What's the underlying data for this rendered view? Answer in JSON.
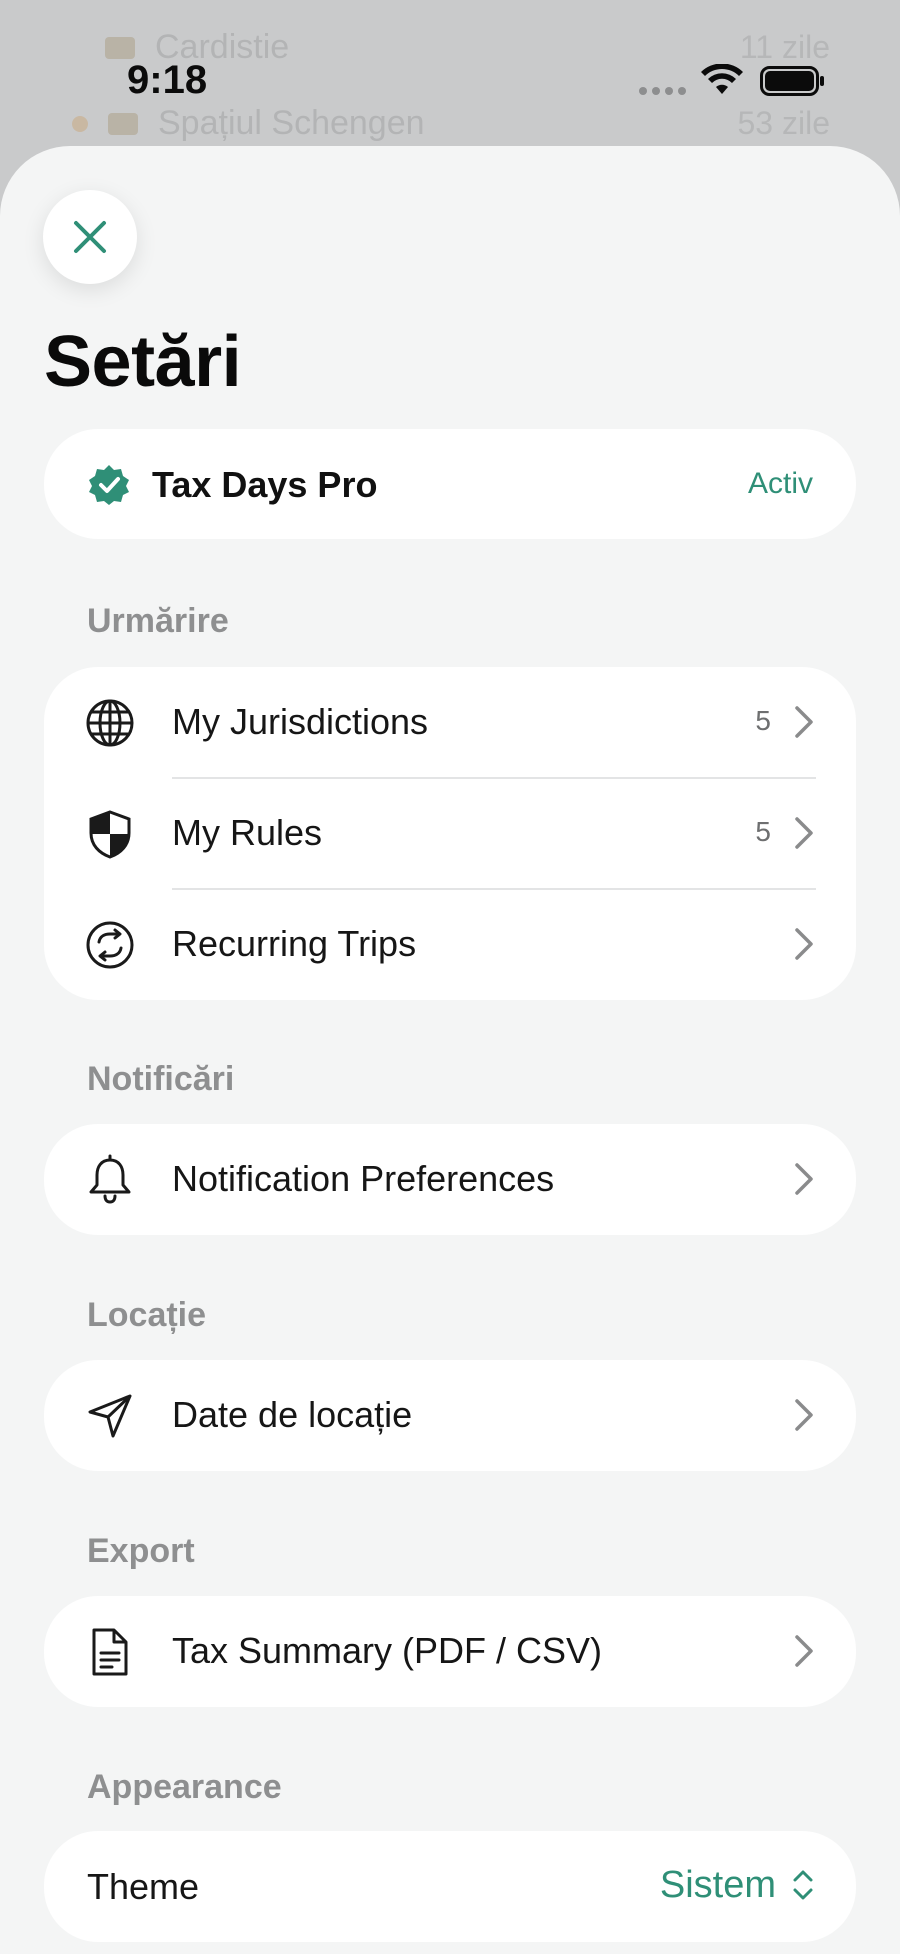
{
  "background": {
    "row1_label": "Cardistie",
    "row1_value": "11 zile",
    "row2_label": "Spațiul Schengen",
    "row2_value": "53 zile"
  },
  "status_bar": {
    "time": "9:18"
  },
  "colors": {
    "accent": "#2f8f77",
    "sheet_background": "#f4f5f5",
    "card_background": "#ffffff",
    "section_label": "#8e8f90"
  },
  "header": {
    "close_icon": "close-icon",
    "title": "Setări"
  },
  "pro": {
    "name": "Tax Days Pro",
    "status": "Activ",
    "icon": "verified-badge-icon"
  },
  "sections": {
    "tracking": {
      "label": "Urmărire",
      "items": [
        {
          "label": "My Jurisdictions",
          "count": "5",
          "icon": "globe-icon"
        },
        {
          "label": "My Rules",
          "count": "5",
          "icon": "shield-icon"
        },
        {
          "label": "Recurring Trips",
          "count": "",
          "icon": "recurring-arrows-icon"
        }
      ]
    },
    "notifications": {
      "label": "Notificări",
      "items": [
        {
          "label": "Notification Preferences",
          "icon": "bell-icon"
        }
      ]
    },
    "location": {
      "label": "Locație",
      "items": [
        {
          "label": "Date de locație",
          "icon": "location-arrow-icon"
        }
      ]
    },
    "export": {
      "label": "Export",
      "items": [
        {
          "label": "Tax Summary (PDF / CSV)",
          "icon": "document-icon"
        }
      ]
    },
    "appearance": {
      "label": "Appearance",
      "theme_label": "Theme",
      "theme_value": "Sistem"
    }
  }
}
